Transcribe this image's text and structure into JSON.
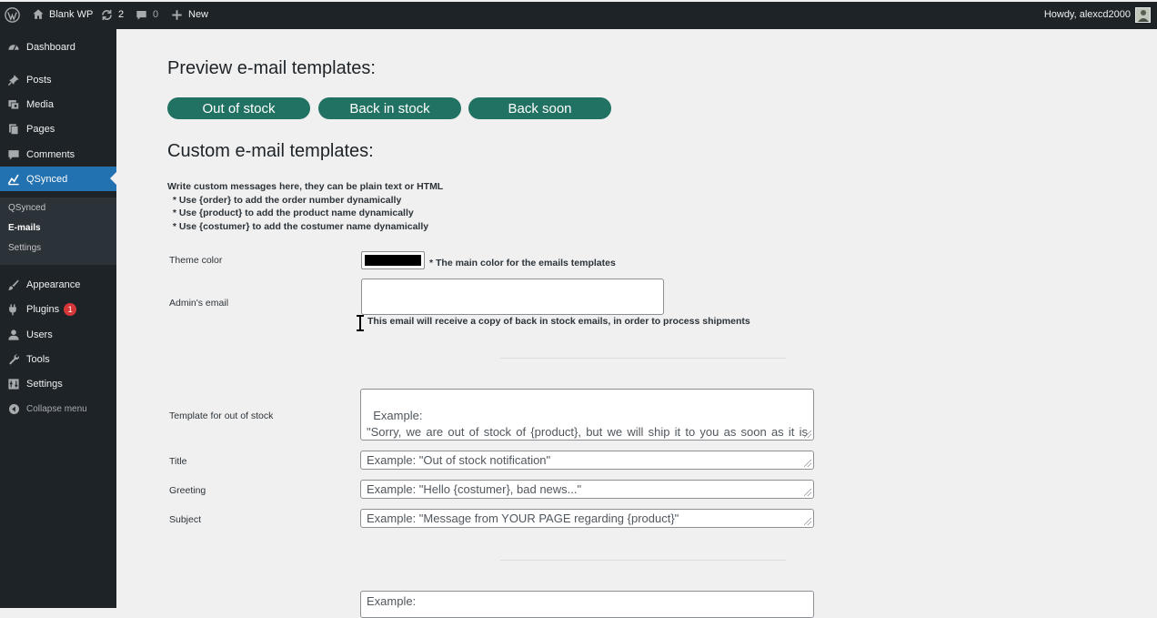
{
  "admin_bar": {
    "site_name": "Blank WP",
    "updates_count": "2",
    "comments_count": "0",
    "new_label": "New",
    "howdy": "Howdy, alexcd2000"
  },
  "sidebar": {
    "items": [
      {
        "label": "Dashboard",
        "icon": "dashboard-icon"
      },
      {
        "label": "Posts",
        "icon": "pin-icon"
      },
      {
        "label": "Media",
        "icon": "media-icon"
      },
      {
        "label": "Pages",
        "icon": "pages-icon"
      },
      {
        "label": "Comments",
        "icon": "comment-icon"
      },
      {
        "label": "QSynced",
        "icon": "chart-icon"
      },
      {
        "label": "Appearance",
        "icon": "brush-icon"
      },
      {
        "label": "Plugins",
        "icon": "plugin-icon",
        "badge": "1"
      },
      {
        "label": "Users",
        "icon": "user-icon"
      },
      {
        "label": "Tools",
        "icon": "wrench-icon"
      },
      {
        "label": "Settings",
        "icon": "settings-icon"
      },
      {
        "label": "Collapse menu",
        "icon": "collapse-icon"
      }
    ],
    "submenu": [
      "QSynced",
      "E-mails",
      "Settings"
    ],
    "accent": "#2271b1"
  },
  "main": {
    "preview_heading": "Preview e-mail templates:",
    "preview_buttons": [
      "Out of stock",
      "Back in stock",
      "Back soon"
    ],
    "custom_heading": "Custom e-mail templates:",
    "instructions": [
      "Write custom messages here, they can be plain text or HTML",
      "  * Use {order} to add the order number dynamically",
      "  * Use {product} to add the product name dynamically",
      "  * Use {costumer} to add the costumer name dynamically"
    ],
    "theme_color": {
      "label": "Theme color",
      "value": "#000000",
      "note": "* The main color for the emails templates"
    },
    "admin_email": {
      "label": "Admin's email",
      "value": "",
      "note": "This email will receive a copy of back in stock emails, in order to process shipments"
    },
    "out_of_stock": {
      "template_label": "Template for out of stock",
      "template_placeholder": "Example:\n\"Sorry, we are out of stock of {product}, but we will ship it to you as soon as it is available again. Sorry for any inconvenients.\"",
      "title_label": "Title",
      "title_placeholder": "Example: \"Out of stock notification\"",
      "greeting_label": "Greeting",
      "greeting_placeholder": "Example: \"Hello {costumer}, bad news...\"",
      "subject_label": "Subject",
      "subject_placeholder": "Example: \"Message from YOUR PAGE regarding {product}\""
    },
    "next_template_placeholder": "Example:",
    "button_color": "#217263"
  }
}
